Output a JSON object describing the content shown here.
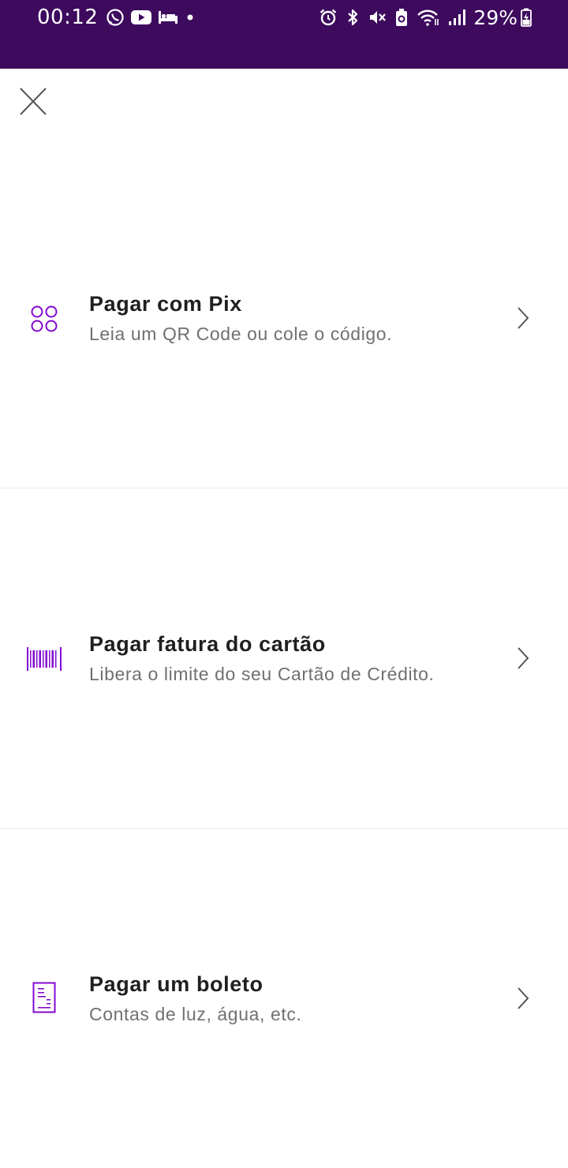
{
  "status_bar": {
    "time": "00:12",
    "battery_percent": "29%",
    "background_color": "#3d0a5e",
    "left_icons": [
      "whatsapp-icon",
      "youtube-icon",
      "sleep-mode-icon",
      "notification-dot-icon"
    ],
    "right_icons": [
      "alarm-icon",
      "bluetooth-icon",
      "vibrate-mute-icon",
      "battery-saver-icon",
      "wifi-icon",
      "signal-icon",
      "battery-charging-icon"
    ]
  },
  "header": {
    "close_icon": "close-icon"
  },
  "accent_color": "#820ad1",
  "options": [
    {
      "icon": "pix-icon",
      "title": "Pagar com Pix",
      "subtitle": "Leia um QR Code ou cole o código."
    },
    {
      "icon": "barcode-icon",
      "title": "Pagar fatura do cartão",
      "subtitle": "Libera o limite do seu Cartão de Crédito."
    },
    {
      "icon": "boleto-icon",
      "title": "Pagar um boleto",
      "subtitle": "Contas de luz, água, etc."
    }
  ]
}
